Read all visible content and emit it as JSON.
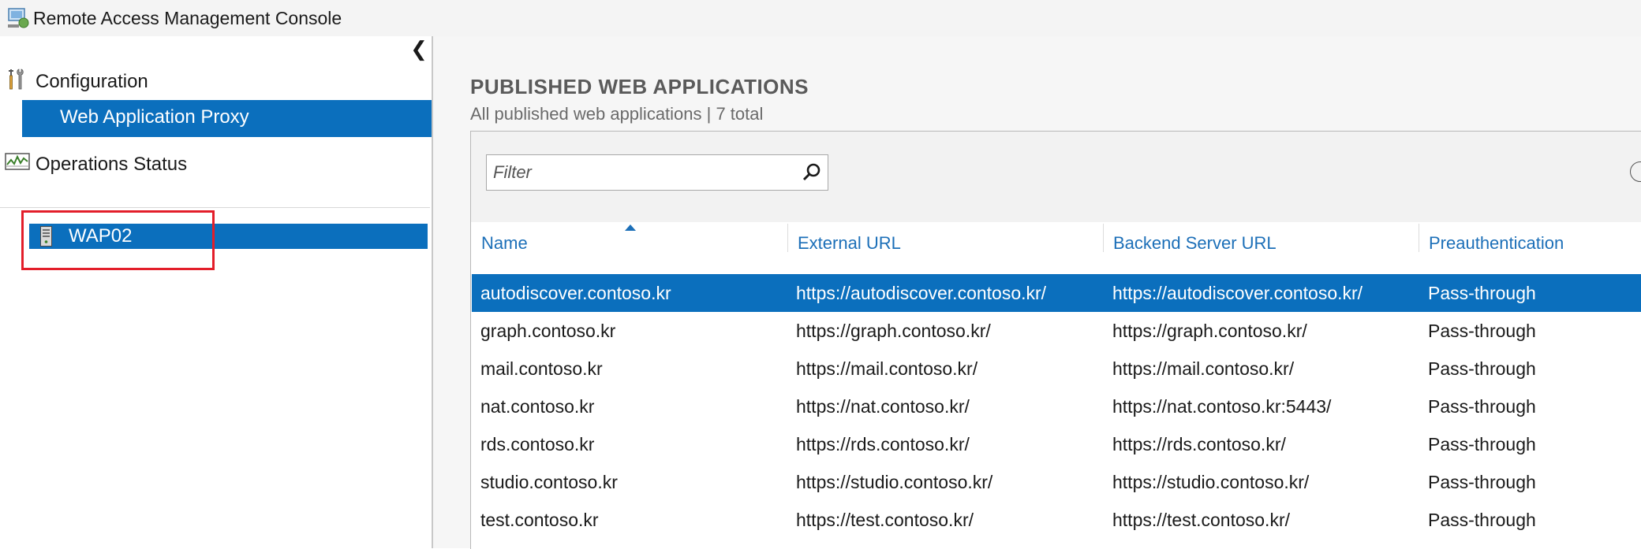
{
  "window": {
    "title": "Remote Access Management Console"
  },
  "left_pane": {
    "collapse_glyph": "❮",
    "nav": {
      "configuration": "Configuration",
      "web_application_proxy": "Web Application Proxy",
      "operations_status": "Operations Status"
    },
    "server": "WAP02"
  },
  "main": {
    "title": "PUBLISHED WEB APPLICATIONS",
    "subtitle": "All published web applications | 7 total",
    "filter_placeholder": "Filter",
    "columns": [
      "Name",
      "External URL",
      "Backend Server URL",
      "Preauthentication"
    ],
    "rows": [
      [
        "autodiscover.contoso.kr",
        "https://autodiscover.contoso.kr/",
        "https://autodiscover.contoso.kr/",
        "Pass-through"
      ],
      [
        "graph.contoso.kr",
        "https://graph.contoso.kr/",
        "https://graph.contoso.kr/",
        "Pass-through"
      ],
      [
        "mail.contoso.kr",
        "https://mail.contoso.kr/",
        "https://mail.contoso.kr/",
        "Pass-through"
      ],
      [
        "nat.contoso.kr",
        "https://nat.contoso.kr/",
        "https://nat.contoso.kr:5443/",
        "Pass-through"
      ],
      [
        "rds.contoso.kr",
        "https://rds.contoso.kr/",
        "https://rds.contoso.kr/",
        "Pass-through"
      ],
      [
        "studio.contoso.kr",
        "https://studio.contoso.kr/",
        "https://studio.contoso.kr/",
        "Pass-through"
      ],
      [
        "test.contoso.kr",
        "https://test.contoso.kr/",
        "https://test.contoso.kr/",
        "Pass-through"
      ]
    ],
    "selected_row": 0
  },
  "colors": {
    "accent": "#0b6fbd",
    "header_link": "#1c6fb8",
    "highlight_box": "#e31e2a"
  },
  "icons": [
    "console-app-icon",
    "tools-icon",
    "monitor-chart-icon",
    "server-icon",
    "search-icon",
    "more-options-icon"
  ]
}
